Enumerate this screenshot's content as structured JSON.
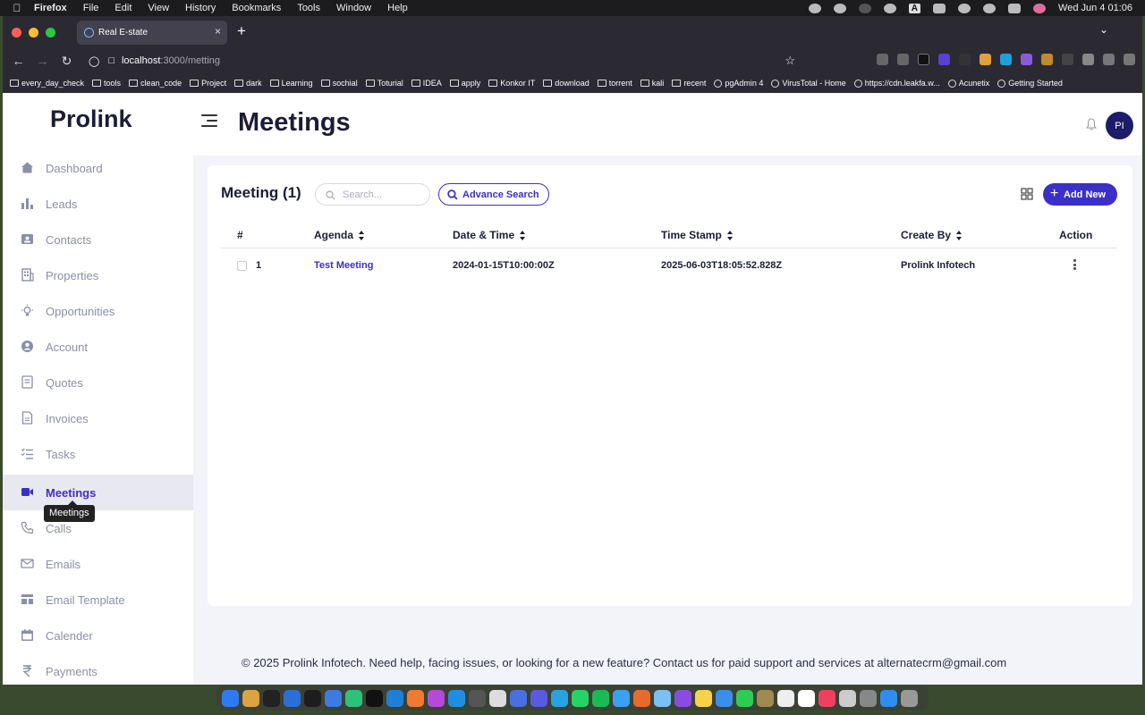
{
  "menubar": {
    "app_name": "Firefox",
    "items": [
      "File",
      "Edit",
      "View",
      "History",
      "Bookmarks",
      "Tools",
      "Window",
      "Help"
    ],
    "clock": "Wed Jun 4  01:06",
    "tray_text": "A"
  },
  "browser": {
    "tab_title": "Real E-state",
    "url_host": "localhost",
    "url_path": ":3000/metting",
    "bookmarks": [
      {
        "label": "every_day_check",
        "icon": "folder-icon"
      },
      {
        "label": "tools",
        "icon": "folder-icon"
      },
      {
        "label": "clean_code",
        "icon": "folder-icon"
      },
      {
        "label": "Project",
        "icon": "folder-icon"
      },
      {
        "label": "dark",
        "icon": "folder-icon"
      },
      {
        "label": "Learning",
        "icon": "folder-icon"
      },
      {
        "label": "sochial",
        "icon": "folder-icon"
      },
      {
        "label": "Toturial",
        "icon": "folder-icon"
      },
      {
        "label": "IDEA",
        "icon": "folder-icon"
      },
      {
        "label": "apply",
        "icon": "folder-icon"
      },
      {
        "label": "Konkor IT",
        "icon": "folder-icon"
      },
      {
        "label": "download",
        "icon": "folder-icon"
      },
      {
        "label": "torrent",
        "icon": "folder-icon"
      },
      {
        "label": "kali",
        "icon": "folder-icon"
      },
      {
        "label": "recent",
        "icon": "folder-icon"
      },
      {
        "label": "pgAdmin 4",
        "icon": "globe-icon"
      },
      {
        "label": "VirusTotal - Home",
        "icon": "globe-icon"
      },
      {
        "label": "https://cdn.leakfa.w...",
        "icon": "globe-icon"
      },
      {
        "label": "Acunetix",
        "icon": "globe-icon"
      },
      {
        "label": "Getting Started",
        "icon": "globe-icon"
      }
    ]
  },
  "app": {
    "brand": "Prolink",
    "page_title": "Meetings",
    "avatar_initials": "PI",
    "accent_color": "#3b2fc9"
  },
  "sidebar": {
    "items": [
      {
        "label": "Dashboard",
        "icon": "home-icon"
      },
      {
        "label": "Leads",
        "icon": "bar-chart-icon"
      },
      {
        "label": "Contacts",
        "icon": "contact-card-icon"
      },
      {
        "label": "Properties",
        "icon": "building-icon"
      },
      {
        "label": "Opportunities",
        "icon": "lightbulb-icon"
      },
      {
        "label": "Account",
        "icon": "account-circle-icon"
      },
      {
        "label": "Quotes",
        "icon": "quote-icon"
      },
      {
        "label": "Invoices",
        "icon": "invoice-icon"
      },
      {
        "label": "Tasks",
        "icon": "task-list-icon"
      },
      {
        "label": "Meetings",
        "icon": "video-camera-icon"
      },
      {
        "label": "Calls",
        "icon": "phone-icon"
      },
      {
        "label": "Emails",
        "icon": "mail-icon"
      },
      {
        "label": "Email Template",
        "icon": "template-icon"
      },
      {
        "label": "Calender",
        "icon": "calendar-icon"
      },
      {
        "label": "Payments",
        "icon": "rupee-icon"
      }
    ],
    "active": "Meetings",
    "tooltip": "Meetings"
  },
  "meetings": {
    "title": "Meeting (1)",
    "search_placeholder": "Search...",
    "advance_search_label": "Advance Search",
    "add_new_label": "Add New",
    "columns": [
      "#",
      "Agenda",
      "Date & Time",
      "Time Stamp",
      "Create By",
      "Action"
    ],
    "rows": [
      {
        "index": "1",
        "agenda": "Test Meeting",
        "date_time": "2024-01-15T10:00:00Z",
        "time_stamp": "2025-06-03T18:05:52.828Z",
        "created_by": "Prolink Infotech"
      }
    ]
  },
  "footer": {
    "text": "© 2025  Prolink Infotech. Need help, facing issues, or looking for a new feature? Contact us for paid support and services at alternatecrm@gmail.com"
  }
}
